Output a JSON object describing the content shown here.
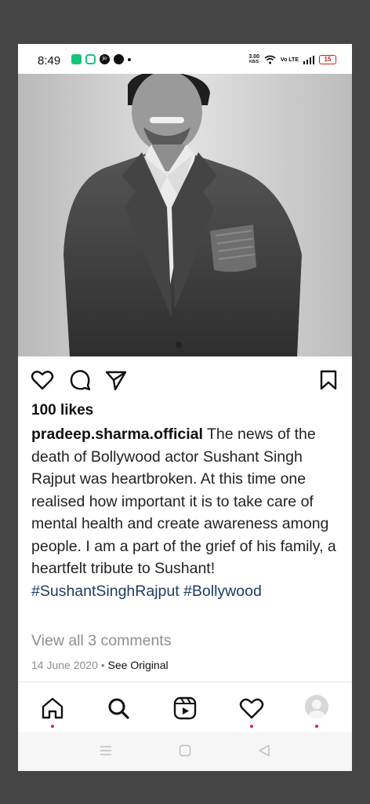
{
  "status_bar": {
    "time": "8:49",
    "net_speed_value": "3.00",
    "net_speed_unit": "KB/S",
    "volte": "Vo LTE",
    "battery": "15"
  },
  "post": {
    "likes": "100 likes",
    "username": "pradeep.sharma.official",
    "caption": "The news of the death of Bollywood actor Sushant Singh Rajput was heartbroken. At this time one realised how important it is to take care of mental health and create awareness among people. I am a part of the grief of his family, a heartfelt tribute to Sushant!",
    "hashtags": "#SushantSinghRajput #Bollywood",
    "view_comments": "View all 3 comments",
    "date": "14 June 2020",
    "separator": "•",
    "see_original": "See Original"
  },
  "colors": {
    "background": "#454545",
    "hashtag": "#1e3a64",
    "notification_dot": "#e0243c",
    "muted_text": "#8e8e8e"
  },
  "icons": {
    "actions": [
      "heart-icon",
      "comment-icon",
      "share-icon",
      "bookmark-icon"
    ],
    "nav": [
      "home-icon",
      "search-icon",
      "reels-icon",
      "activity-heart-icon",
      "profile-avatar"
    ],
    "system": [
      "menu-icon",
      "home-square-icon",
      "back-triangle-icon"
    ]
  }
}
